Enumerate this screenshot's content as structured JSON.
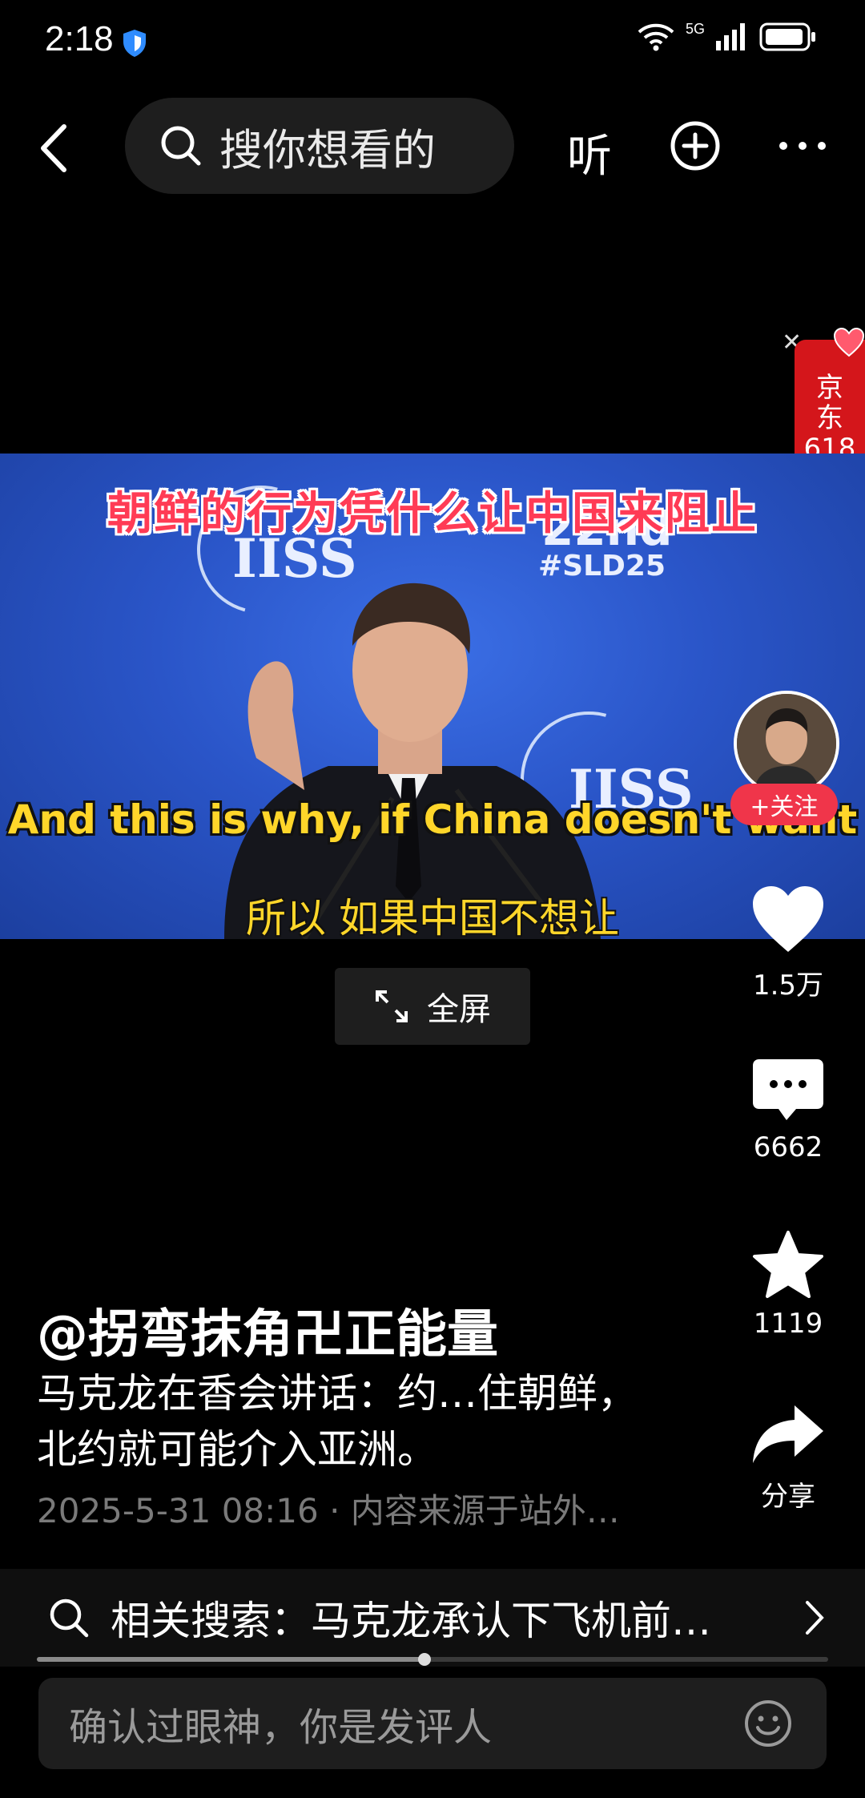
{
  "status": {
    "time": "2:18",
    "network": "5G",
    "battery_icon": "battery-icon"
  },
  "top_bar": {
    "search_placeholder": "搜你想看的",
    "listen_label": "听"
  },
  "ad": {
    "text": [
      "京",
      "东",
      "618"
    ]
  },
  "video": {
    "logo_left": "IISS",
    "logo_right": "IISS",
    "event_number": "22nd",
    "event_tag": "#SLD25",
    "title_cn": "朝鲜的行为凭什么让中国来阻止",
    "subtitle_en": "And this is why, if China doesn't want",
    "subtitle_cn": "所以 如果中国不想让"
  },
  "fullscreen_label": "全屏",
  "side_rail": {
    "follow_label": "+关注",
    "likes": "1.5万",
    "comments": "6662",
    "favorites": "1119",
    "share_label": "分享"
  },
  "post": {
    "author": "@拐弯抹角卍正能量",
    "description": "马克龙在香会讲话：约…住朝鲜，北约就可能介入亚洲。",
    "meta": "2025-5-31 08:16 · 内容来源于站外…"
  },
  "related_search": {
    "text": "相关搜索：马克龙承认下飞机前…"
  },
  "progress": {
    "played_fraction": 0.49
  },
  "comment_input": {
    "placeholder": "确认过眼神，你是发评人"
  },
  "colors": {
    "accent_red": "#f0354a",
    "subtitle_yellow": "#ffd62a",
    "ad_red": "#d4161b"
  }
}
